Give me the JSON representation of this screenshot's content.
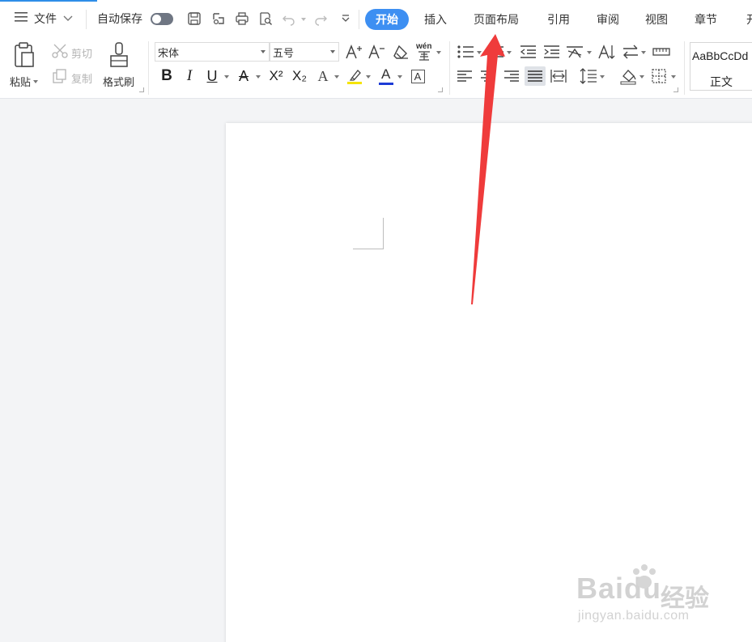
{
  "menubar": {
    "file_label": "文件",
    "autosave_label": "自动保存",
    "tabs": [
      {
        "label": "开始"
      },
      {
        "label": "插入"
      },
      {
        "label": "页面布局"
      },
      {
        "label": "引用"
      },
      {
        "label": "审阅"
      },
      {
        "label": "视图"
      },
      {
        "label": "章节"
      },
      {
        "label": "开"
      }
    ],
    "accent_color": "#3d8ff2"
  },
  "ribbon": {
    "clipboard": {
      "paste_label": "粘贴",
      "cut_label": "剪切",
      "copy_label": "复制",
      "format_painter_label": "格式刷"
    },
    "font": {
      "font_name": "宋体",
      "font_size": "五号",
      "phonetic_label": "wén",
      "bold": "B",
      "italic": "I",
      "underline": "U",
      "strike": "A",
      "superscript": "X²",
      "subscript": "X₂",
      "text_effect": "A",
      "font_color": "A",
      "char_border": "A",
      "highlight_color": "#f5e400",
      "font_color_value": "#1d3bd6"
    },
    "styles": {
      "preview_text": "AaBbCcDd",
      "style_name": "正文"
    }
  },
  "annotation": {
    "arrow_color": "#ef3b3b"
  },
  "watermark": {
    "brand": "Baidu",
    "brand_cn": "经验",
    "url": "jingyan.baidu.com"
  }
}
